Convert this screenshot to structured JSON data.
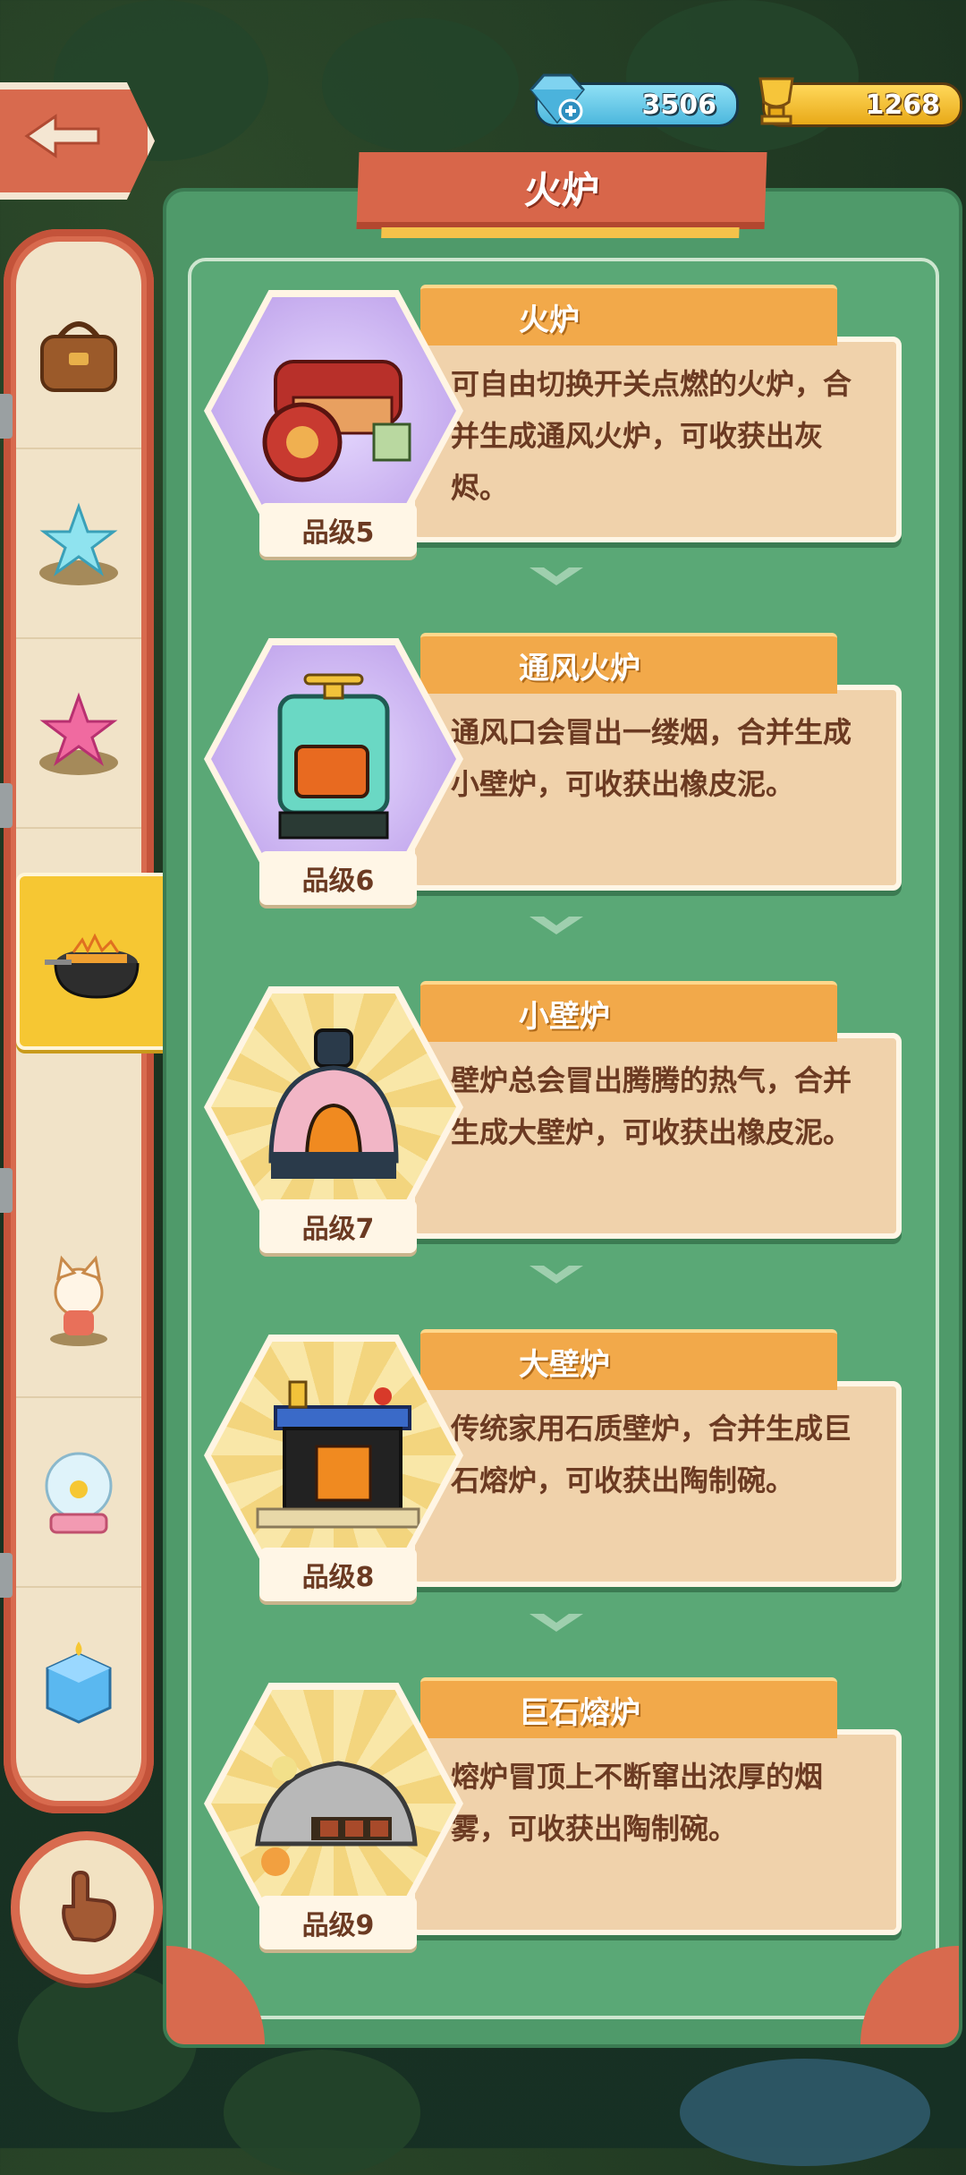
{
  "currency": {
    "gems": "3506",
    "gold": "1268"
  },
  "panel": {
    "title": "火炉"
  },
  "entries": [
    {
      "name": "火炉",
      "desc": "可自由切换开关点燃的火炉，合并生成通风火炉，可收获出灰烬。",
      "grade": "品级5",
      "icon": "grill-stove-icon",
      "bg": "purple"
    },
    {
      "name": "通风火炉",
      "desc": "通风口会冒出一缕烟，合并生成小壁炉，可收获出橡皮泥。",
      "grade": "品级6",
      "icon": "vent-stove-icon",
      "bg": "purple"
    },
    {
      "name": "小壁炉",
      "desc": "壁炉总会冒出腾腾的热气，合并生成大壁炉，可收获出橡皮泥。",
      "grade": "品级7",
      "icon": "small-fireplace-icon",
      "bg": "yellow"
    },
    {
      "name": "大壁炉",
      "desc": "传统家用石质壁炉，合并生成巨石熔炉，可收获出陶制碗。",
      "grade": "品级8",
      "icon": "large-fireplace-icon",
      "bg": "yellow"
    },
    {
      "name": "巨石熔炉",
      "desc": "熔炉冒顶上不断窜出浓厚的烟雾，可收获出陶制碗。",
      "grade": "品级9",
      "icon": "stone-furnace-icon",
      "bg": "yellow"
    }
  ],
  "sidebar": {
    "items": [
      {
        "icon": "bag-icon"
      },
      {
        "icon": "blue-star-icon"
      },
      {
        "icon": "pink-star-icon"
      },
      {
        "icon": "stove-icon",
        "selected": true
      },
      {
        "icon": "cat-icon"
      },
      {
        "icon": "snow-globe-icon"
      },
      {
        "icon": "ice-cube-icon"
      },
      {
        "icon": "key-icon"
      }
    ],
    "bottom_button_icon": "hand-icon"
  },
  "colors": {
    "accent": "#d86a4e",
    "panel": "#4f9a6a",
    "tab": "#f2a94a",
    "desc": "#f0d2ab",
    "text": "#6b3a22"
  }
}
